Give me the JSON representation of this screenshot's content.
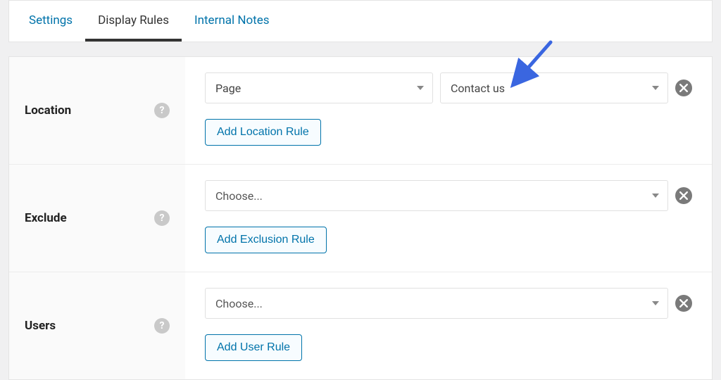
{
  "tabs": {
    "settings": "Settings",
    "display_rules": "Display Rules",
    "internal_notes": "Internal Notes"
  },
  "rows": {
    "location": {
      "label": "Location",
      "dropdown1": "Page",
      "dropdown2": "Contact us",
      "add_btn": "Add Location Rule"
    },
    "exclude": {
      "label": "Exclude",
      "dropdown_placeholder": "Choose...",
      "add_btn": "Add Exclusion Rule"
    },
    "users": {
      "label": "Users",
      "dropdown_placeholder": "Choose...",
      "add_btn": "Add User Rule"
    }
  }
}
